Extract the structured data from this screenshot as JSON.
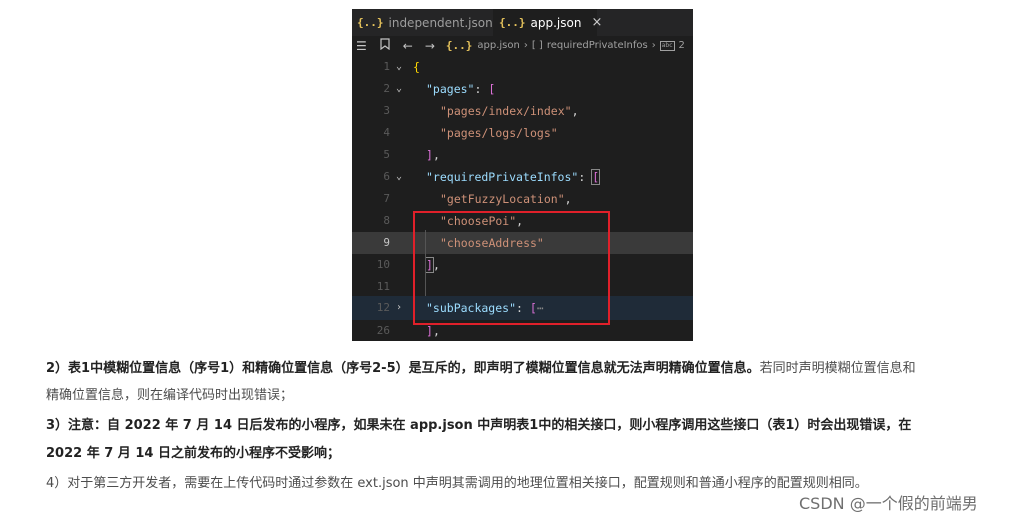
{
  "editor": {
    "tabs": [
      {
        "icon": "{..}",
        "label": "independent.json"
      },
      {
        "icon": "{..}",
        "label": "app.json",
        "close": "×"
      }
    ],
    "breadcrumb": {
      "file": "app.json",
      "array_icon": "[ ]",
      "key": "requiredPrivateInfos",
      "count_icon": "abc",
      "count": "2"
    },
    "lines": [
      {
        "num": "1",
        "fold": "open"
      },
      {
        "num": "2",
        "fold": "open"
      },
      {
        "num": "3"
      },
      {
        "num": "4"
      },
      {
        "num": "5"
      },
      {
        "num": "6",
        "fold": "open"
      },
      {
        "num": "7"
      },
      {
        "num": "8"
      },
      {
        "num": "9",
        "current": true
      },
      {
        "num": "10"
      },
      {
        "num": "11"
      },
      {
        "num": "12",
        "fold": "closed"
      },
      {
        "num": "26"
      }
    ],
    "code": {
      "pages_key": "\"pages\"",
      "page1": "\"pages/index/index\"",
      "page2": "\"pages/logs/logs\"",
      "rpi_key": "\"requiredPrivateInfos\"",
      "rpi1": "\"getFuzzyLocation\"",
      "rpi2": "\"choosePoi\"",
      "rpi3": "\"chooseAddress\"",
      "sub_key": "\"subPackages\"",
      "ellipsis": "⋯"
    }
  },
  "article": {
    "p2_bold": "2）表1中模糊位置信息（序号1）和精确位置信息（序号2-5）是互斥的，即声明了模糊位置信息就无法声明精确位置信息。",
    "p2_rest": "若同时声明模糊位置信息和",
    "p2_line2": "精确位置信息，则在编译代码时出现错误；",
    "p3_line1": "3）注意：自 2022 年 7 月 14 日后发布的小程序，如果未在 app.json 中声明表1中的相关接口，则小程序调用这些接口（表1）时会出现错误，在",
    "p3_line2": "2022 年 7 月 14 日之前发布的小程序不受影响；",
    "p4": "4）对于第三方开发者，需要在上传代码时通过参数在 ext.json 中声明其需调用的地理位置相关接口，配置规则和普通小程序的配置规则相同。"
  },
  "watermark": "CSDN @一个假的前端男"
}
